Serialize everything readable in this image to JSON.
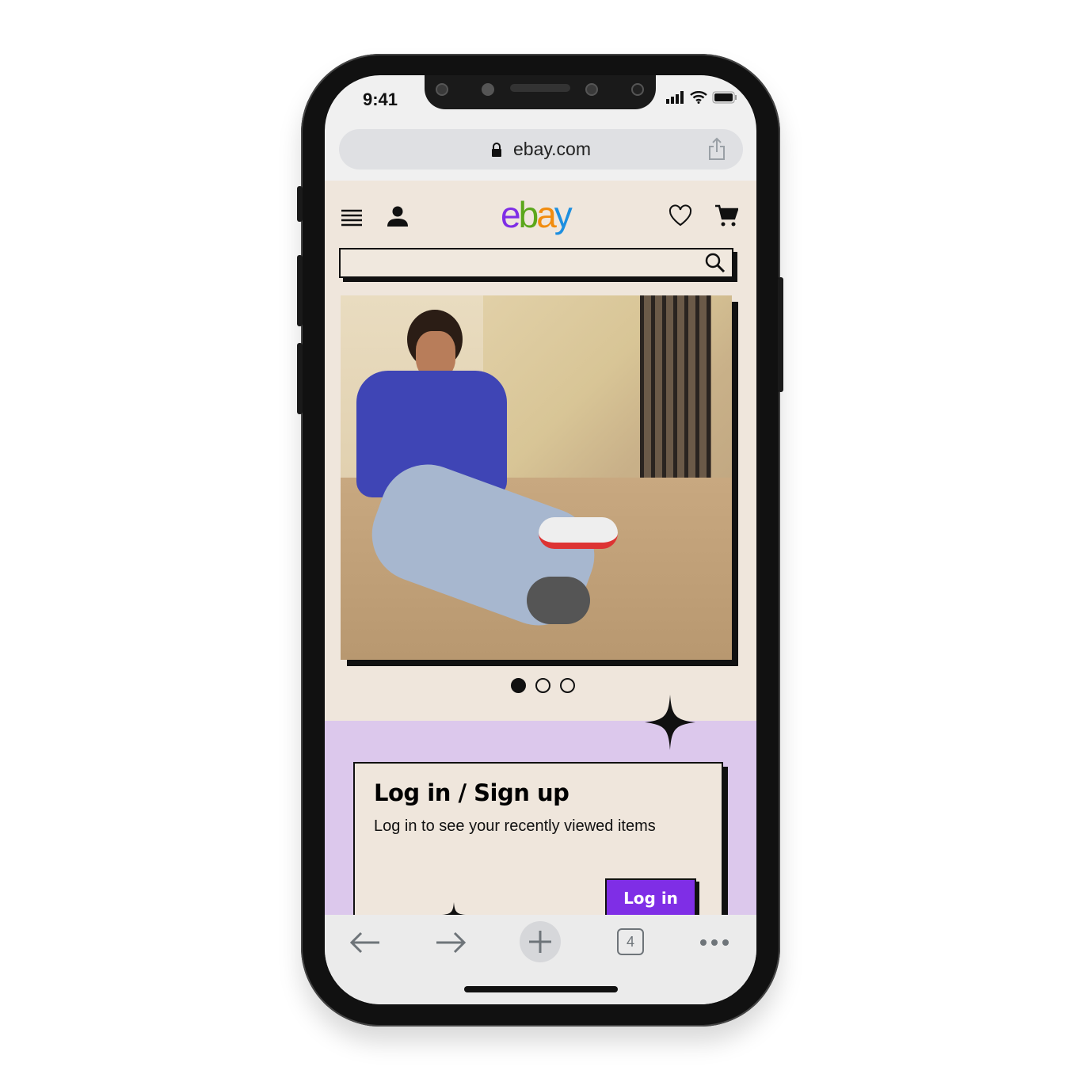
{
  "status_bar": {
    "time": "9:41"
  },
  "browser": {
    "url": "ebay.com",
    "tab_count": "4"
  },
  "header": {
    "logo": [
      "e",
      "b",
      "a",
      "y"
    ],
    "logo_colors": [
      "#7f2ee6",
      "#5ba71b",
      "#f18c0e",
      "#1d8fe0"
    ]
  },
  "carousel": {
    "total": 3,
    "active_index": 0
  },
  "login_card": {
    "title": "Log in / Sign up",
    "subtitle": "Log in to see your recently viewed items",
    "button": "Log in"
  },
  "colors": {
    "accent": "#7f2ee6",
    "page_bg": "#efe6dc",
    "purple_band": "#dcc8ec"
  }
}
